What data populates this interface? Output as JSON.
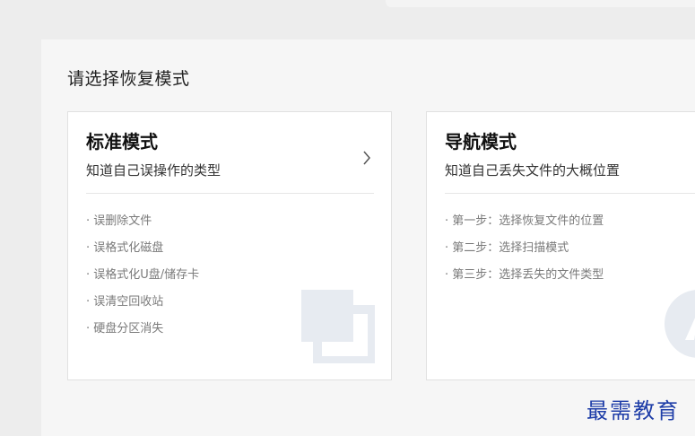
{
  "section_title": "请选择恢复模式",
  "cards": [
    {
      "title": "标准模式",
      "description": "知道自己误操作的类型",
      "items": [
        "· 误删除文件",
        "· 误格式化磁盘",
        "· 误格式化U盘/储存卡",
        "· 误清空回收站",
        "· 硬盘分区消失"
      ]
    },
    {
      "title": "导航模式",
      "description": "知道自己丢失文件的大概位置",
      "items": [
        "· 第一步：选择恢复文件的位置",
        "· 第二步：选择扫描模式",
        "· 第三步：选择丢失的文件类型"
      ]
    }
  ],
  "watermark": "最需教育",
  "colors": {
    "decoration": "#e7ebf1",
    "watermark": "#1f3ea8"
  },
  "icons": {
    "chevron": "chevron-right-icon"
  }
}
